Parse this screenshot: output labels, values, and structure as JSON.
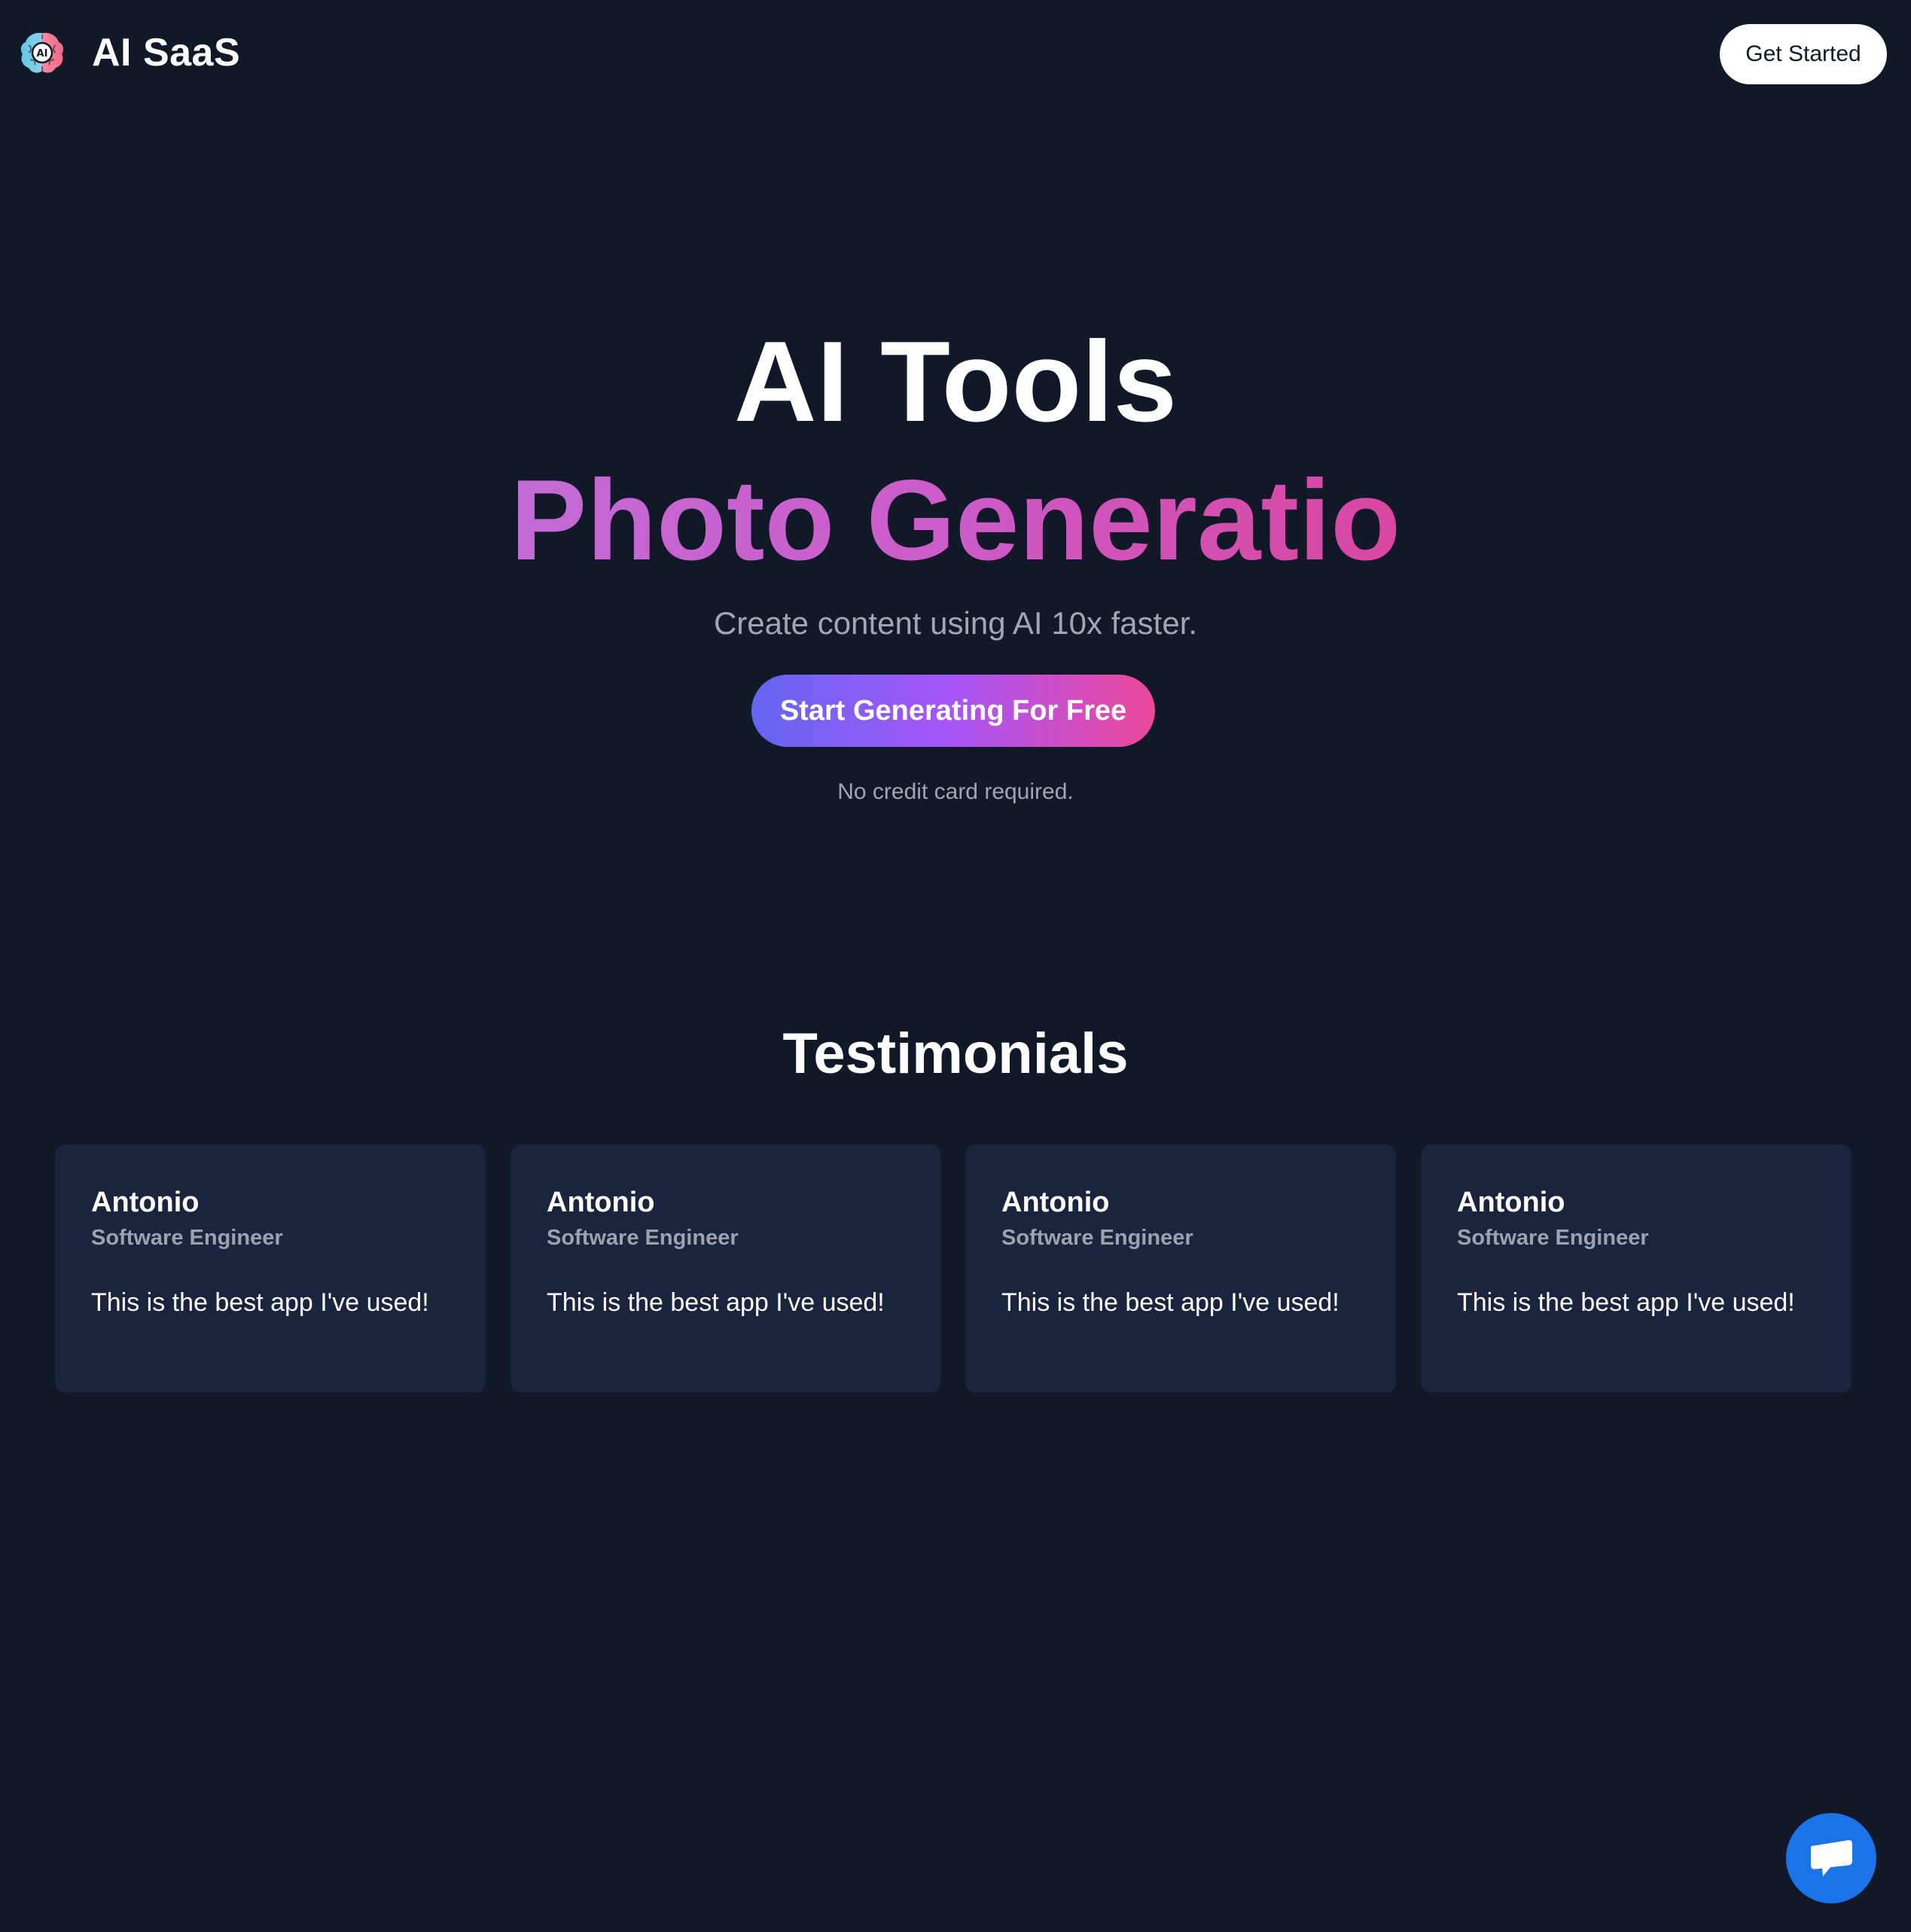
{
  "navbar": {
    "logo_text": "AI SaaS",
    "logo_icon": "brain-ai-icon",
    "get_started_label": "Get Started"
  },
  "hero": {
    "title": "AI Tools",
    "rotating_text": "Photo Generatio",
    "subtitle": "Create content using AI 10x faster.",
    "cta_label": "Start Generating For Free",
    "cta_note": "No credit card required."
  },
  "testimonials": {
    "title": "Testimonials",
    "items": [
      {
        "name": "Antonio",
        "role": "Software Engineer",
        "quote": "This is the best app I've used!"
      },
      {
        "name": "Antonio",
        "role": "Software Engineer",
        "quote": "This is the best app I've used!"
      },
      {
        "name": "Antonio",
        "role": "Software Engineer",
        "quote": "This is the best app I've used!"
      },
      {
        "name": "Antonio",
        "role": "Software Engineer",
        "quote": "This is the best app I've used!"
      }
    ]
  },
  "chat_widget": {
    "icon": "chat-bubble-icon"
  },
  "colors": {
    "background": "#111827",
    "card": "#1a243c",
    "gradient_start": "#6366f1",
    "gradient_mid": "#a855f7",
    "gradient_end": "#ec4899",
    "chat_button": "#1a73e8"
  }
}
